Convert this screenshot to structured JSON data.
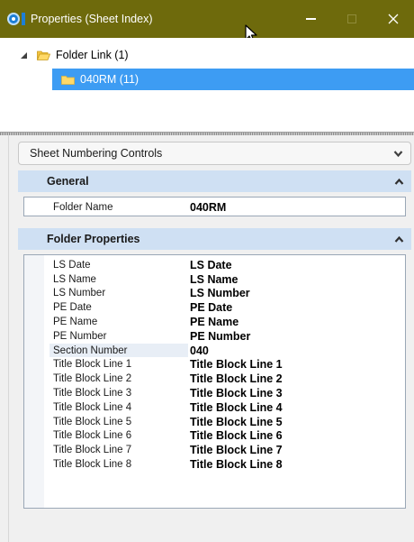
{
  "window": {
    "title": "Properties (Sheet Index)",
    "colors": {
      "titlebar": "#6e6a0c",
      "selection": "#3d9cf3",
      "group_header": "#cfe0f3"
    }
  },
  "tree": {
    "root": {
      "label": "Folder Link (1)",
      "icon": "folder-open-icon"
    },
    "child": {
      "label": "040RM (11)",
      "icon": "folder-icon",
      "selected": true
    }
  },
  "panels": {
    "sheet_numbering": {
      "label": "Sheet Numbering Controls"
    },
    "general": {
      "label": "General",
      "rows": [
        {
          "name": "Folder Name",
          "value": "040RM"
        }
      ]
    },
    "folder_properties": {
      "label": "Folder Properties",
      "rows": [
        {
          "name": "LS Date",
          "value": "LS Date"
        },
        {
          "name": "LS Name",
          "value": "LS Name"
        },
        {
          "name": "LS Number",
          "value": "LS Number"
        },
        {
          "name": "PE Date",
          "value": "PE Date"
        },
        {
          "name": "PE Name",
          "value": "PE Name"
        },
        {
          "name": "PE Number",
          "value": "PE Number"
        },
        {
          "name": "Section Number",
          "value": "040"
        },
        {
          "name": "Title Block Line 1",
          "value": "Title Block Line 1"
        },
        {
          "name": "Title Block Line 2",
          "value": "Title Block Line 2"
        },
        {
          "name": "Title Block Line 3",
          "value": "Title Block Line 3"
        },
        {
          "name": "Title Block Line 4",
          "value": "Title Block Line 4"
        },
        {
          "name": "Title Block Line 5",
          "value": "Title Block Line 5"
        },
        {
          "name": "Title Block Line 6",
          "value": "Title Block Line 6"
        },
        {
          "name": "Title Block Line 7",
          "value": "Title Block Line 7"
        },
        {
          "name": "Title Block Line 8",
          "value": "Title Block Line 8"
        }
      ]
    }
  }
}
